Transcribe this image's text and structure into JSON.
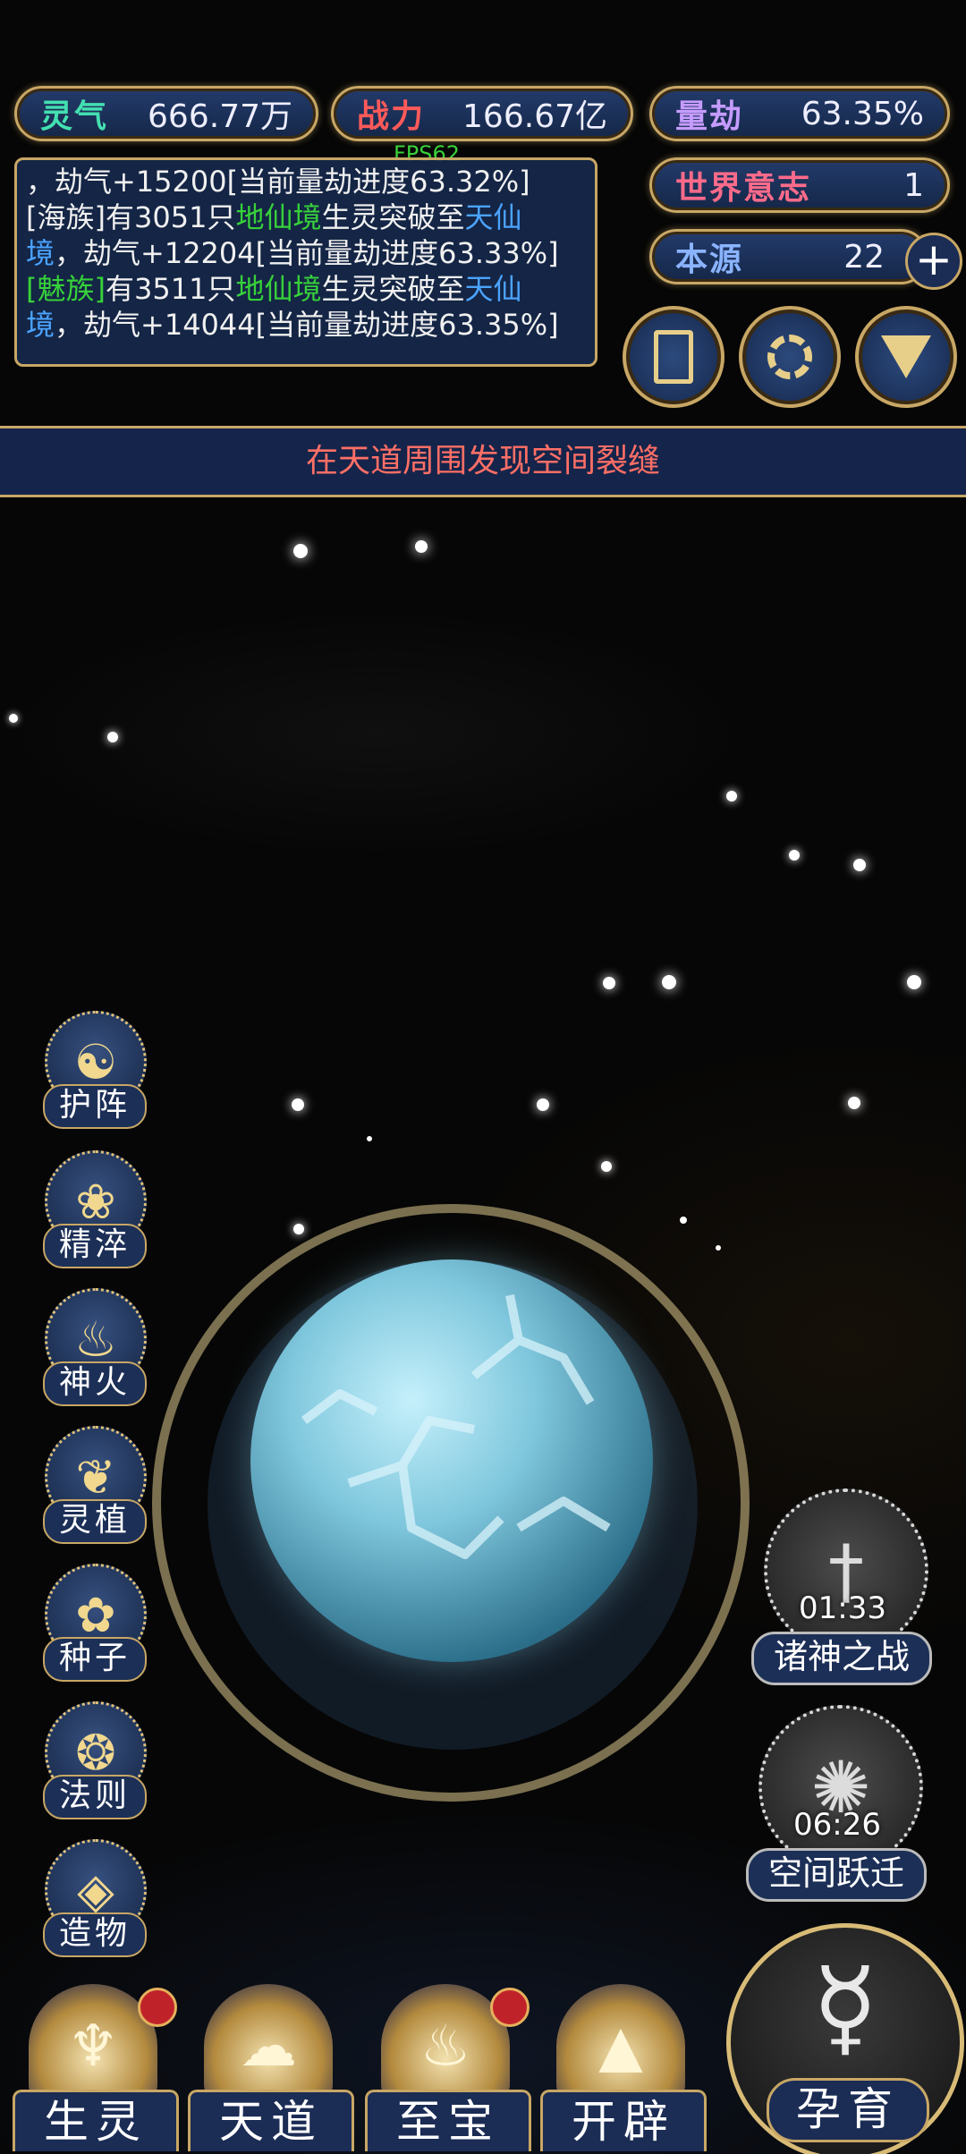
{
  "fps": "FPS62",
  "stats": {
    "lingqi": {
      "label": "灵气",
      "value": "666.77万"
    },
    "zhanli": {
      "label": "战力",
      "value": "166.67亿"
    },
    "liangjie": {
      "label": "量劫",
      "value": "63.35%"
    },
    "shijie": {
      "label": "世界意志",
      "value": "1"
    },
    "benyuan": {
      "label": "本源",
      "value": "22"
    }
  },
  "log": {
    "line1": "，劫气+15200[当前量劫进度63.32%]",
    "entry2": {
      "race": "[海族]",
      "pre": "有3051只",
      "realm1": "地仙境",
      "mid": "生灵突破至",
      "realm2a": "天仙",
      "realm2b": "境",
      "post": "，劫气+12204[当前量劫进度63.33%]"
    },
    "entry3": {
      "race": "[魅族]",
      "pre": "有3511只",
      "realm1": "地仙境",
      "mid": "生灵突破至",
      "realm2a": "天仙",
      "realm2b": "境",
      "post": "，劫气+14044[当前量劫进度63.35%]"
    }
  },
  "top_icons": [
    "card-icon",
    "vortex-icon",
    "banner-flag-icon"
  ],
  "banner": "在天道周围发现空间裂缝",
  "side_buttons": [
    "护阵",
    "精淬",
    "神火",
    "灵植",
    "种子",
    "法则",
    "造物"
  ],
  "events": {
    "battle": {
      "timer": "01:33",
      "label": "诸神之战"
    },
    "jump": {
      "timer": "06:26",
      "label": "空间跃迁"
    }
  },
  "nav": [
    "生灵",
    "天道",
    "至宝",
    "开辟"
  ],
  "big_button": "孕育",
  "colors": {
    "gold": "#c8a765",
    "panel": "#1b2c55",
    "banner_text": "#ff6f66",
    "green": "#37d13a",
    "blue": "#4ba3ff"
  }
}
